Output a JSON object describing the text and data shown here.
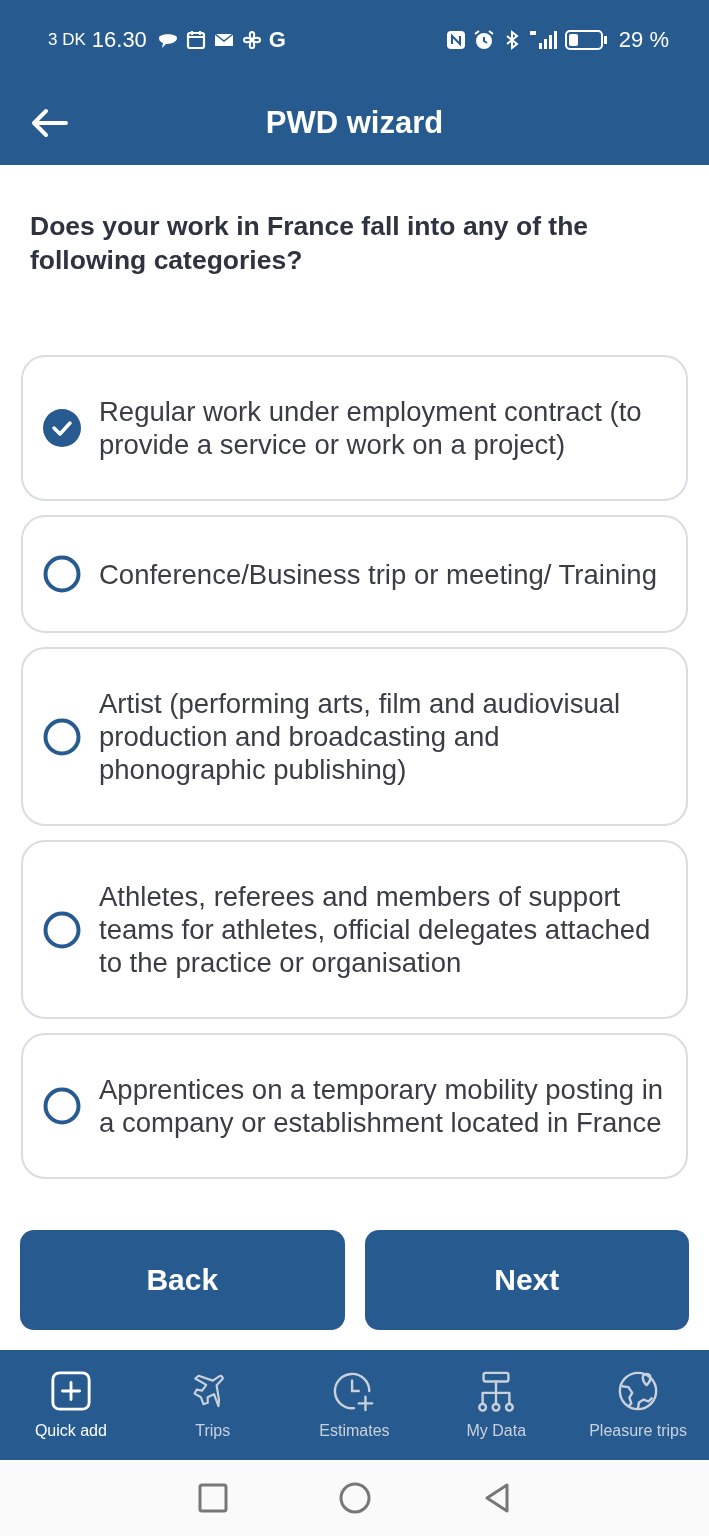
{
  "status_bar": {
    "carrier_time": "3 DK",
    "time": "16.30",
    "app_letter": "G",
    "battery_percent": "29 %"
  },
  "app_bar": {
    "title": "PWD wizard"
  },
  "question": "Does your work in France fall into any of the following categories?",
  "options": [
    {
      "label": "Regular work under employment contract (to provide a service or work on a project)",
      "selected": true
    },
    {
      "label": "Conference/Business trip or meeting/ Training",
      "selected": false
    },
    {
      "label": "Artist (performing arts, film and audiovisual production and broadcasting and phonographic publishing)",
      "selected": false
    },
    {
      "label": "Athletes, referees and members of support teams for athletes, official delegates attached to the practice or organisation",
      "selected": false
    },
    {
      "label": "Apprentices on a temporary mobility posting in a company or establishment located in France",
      "selected": false
    }
  ],
  "buttons": [
    {
      "label": "Back"
    },
    {
      "label": "Next"
    }
  ],
  "bottom_nav": [
    {
      "kind": "add",
      "label": "Quick add",
      "selected": true
    },
    {
      "kind": "plane",
      "label": "Trips",
      "selected": false
    },
    {
      "kind": "clock",
      "label": "Estimates",
      "selected": false
    },
    {
      "kind": "tree",
      "label": "My Data",
      "selected": false
    },
    {
      "kind": "globe",
      "label": "Pleasure trips",
      "selected": false
    }
  ]
}
